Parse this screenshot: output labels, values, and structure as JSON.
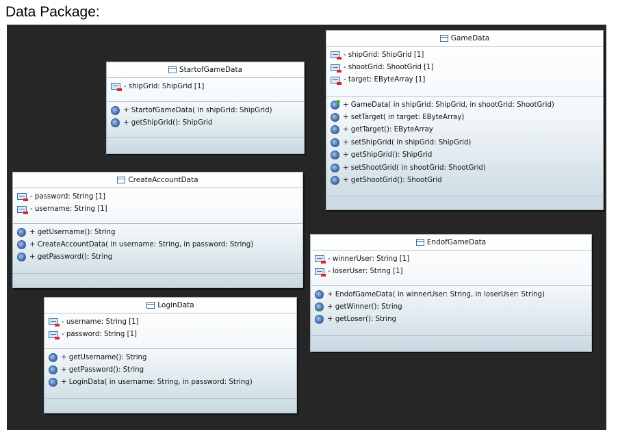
{
  "page_title": "Data Package:",
  "classes": {
    "game": {
      "name": "GameData",
      "attributes": [
        "- shipGrid: ShipGrid [1]",
        "- shootGrid: ShootGrid [1]",
        "- target: EByteArray [1]"
      ],
      "operations": [
        "+ GameData( in shipGrid: ShipGrid,   in shootGrid: ShootGrid)",
        "+ setTarget( in target: EByteArray)",
        "+ getTarget(): EByteArray",
        "+ setShipGrid( in shipGrid: ShipGrid)",
        "+ getShipGrid(): ShipGrid",
        "+ setShootGrid( in shootGrid: ShootGrid)",
        "+ getShootGrid(): ShootGrid"
      ]
    },
    "start": {
      "name": "StartofGameData",
      "attributes": [
        "- shipGrid: ShipGrid [1]"
      ],
      "operations": [
        "+ StartofGameData( in shipGrid: ShipGrid)",
        "+ getShipGrid(): ShipGrid"
      ]
    },
    "create": {
      "name": "CreateAccountData",
      "attributes": [
        "- password: String [1]",
        "- username: String [1]"
      ],
      "operations": [
        "+ getUsername(): String",
        "+ CreateAccountData( in username: String,   in password: String)",
        "+ getPassword(): String"
      ]
    },
    "end": {
      "name": "EndofGameData",
      "attributes": [
        "- winnerUser: String [1]",
        "- loserUser: String [1]"
      ],
      "operations": [
        "+ EndofGameData( in winnerUser: String,   in loserUser: String)",
        "+ getWinner(): String",
        "+ getLoser(): String"
      ]
    },
    "login": {
      "name": "LoginData",
      "attributes": [
        "- username: String [1]",
        "- password: String [1]"
      ],
      "operations": [
        "+ getUsername(): String",
        "+ getPassword(): String",
        "+ LoginData( in username: String,   in password: String)"
      ]
    }
  }
}
